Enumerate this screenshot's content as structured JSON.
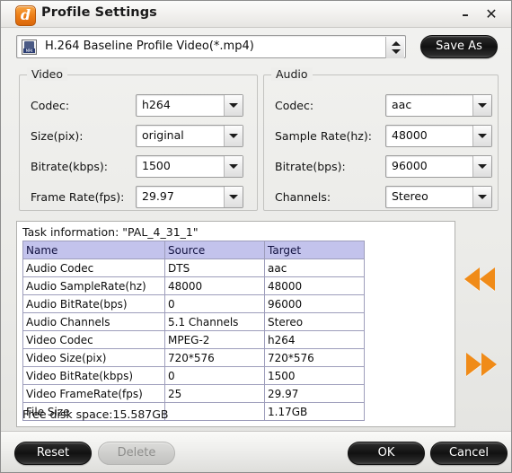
{
  "window": {
    "title": "Profile Settings",
    "app_icon": "app-logo-icon",
    "minimize_label": "–",
    "close_label": "✕"
  },
  "profile": {
    "file_icon": "mp4-file-icon",
    "file_icon_label": "MP4",
    "selected": "H.264 Baseline Profile Video(*.mp4)",
    "save_as_label": "Save As"
  },
  "video": {
    "group_title": "Video",
    "fields": [
      {
        "label": "Codec:",
        "value": "h264"
      },
      {
        "label": "Size(pix):",
        "value": "original"
      },
      {
        "label": "Bitrate(kbps):",
        "value": "1500"
      },
      {
        "label": "Frame Rate(fps):",
        "value": "29.97"
      }
    ]
  },
  "audio": {
    "group_title": "Audio",
    "fields": [
      {
        "label": "Codec:",
        "value": "aac"
      },
      {
        "label": "Sample Rate(hz):",
        "value": "48000"
      },
      {
        "label": "Bitrate(bps):",
        "value": "96000"
      },
      {
        "label": "Channels:",
        "value": "Stereo"
      }
    ]
  },
  "task_info": {
    "title": "Task information: \"PAL_4_31_1\"",
    "columns": [
      "Name",
      "Source",
      "Target"
    ],
    "rows": [
      [
        "Audio Codec",
        "DTS",
        "aac"
      ],
      [
        "Audio SampleRate(hz)",
        "48000",
        "48000"
      ],
      [
        "Audio BitRate(bps)",
        "0",
        "96000"
      ],
      [
        "Audio Channels",
        "5.1 Channels",
        "Stereo"
      ],
      [
        "Video Codec",
        "MPEG-2",
        "h264"
      ],
      [
        "Video Size(pix)",
        "720*576",
        "720*576"
      ],
      [
        "Video BitRate(kbps)",
        "0",
        "1500"
      ],
      [
        "Video FrameRate(fps)",
        "25",
        "29.97"
      ],
      [
        "File Size",
        "",
        "1.17GB"
      ]
    ],
    "free_disk": "Free disk space:15.587GB"
  },
  "nav": {
    "prev_icon": "double-arrow-left-icon",
    "next_icon": "double-arrow-right-icon"
  },
  "footer": {
    "reset_label": "Reset",
    "delete_label": "Delete",
    "ok_label": "OK",
    "cancel_label": "Cancel"
  },
  "colors": {
    "accent_orange": "#ee7f17",
    "table_header": "#c3c3ec",
    "window_bg": "#eeeeec"
  }
}
